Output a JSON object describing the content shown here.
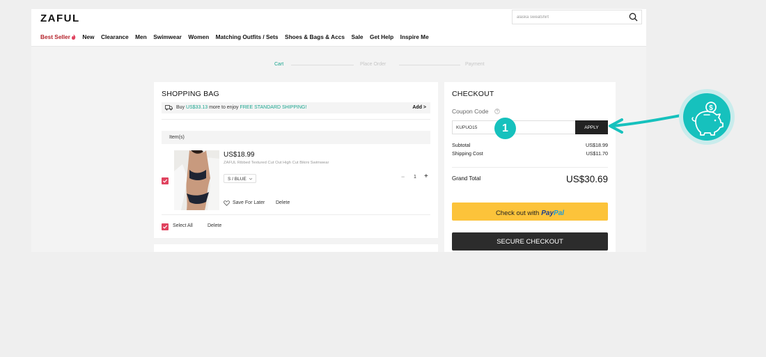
{
  "header": {
    "logo": "ZAFUL",
    "search_placeholder": "alaska sweatshirt",
    "nav": [
      "Best Seller",
      "New",
      "Clearance",
      "Men",
      "Swimwear",
      "Women",
      "Matching Outfits / Sets",
      "Shoes & Bags & Accs",
      "Sale",
      "Get Help",
      "Inspire Me"
    ]
  },
  "steps": [
    "Cart",
    "Place Order",
    "Payment"
  ],
  "bag": {
    "title": "SHOPPING BAG",
    "ship_prefix": "Buy ",
    "ship_amount": "US$33.13",
    "ship_middle": " more to enjoy ",
    "ship_offer": "FREE STANDARD SHIPPING!",
    "add_link": "Add >",
    "items_header": "Item(s)",
    "item": {
      "price": "US$18.99",
      "name": "ZAFUL Ribbed Textured Cut Out High Cut Bikini Swimwear",
      "variant": "S / BLUE",
      "qty": "1",
      "save_later": "Save For Later",
      "delete": "Delete"
    },
    "select_all": "Select All",
    "delete": "Delete"
  },
  "checkout": {
    "title": "CHECKOUT",
    "coupon_label": "Coupon Code",
    "coupon_value": "KUPUO15",
    "apply": "APPLY",
    "subtotal_label": "Subtotal",
    "subtotal_value": "US$18.99",
    "shipping_label": "Shipping Cost",
    "shipping_value": "US$11.70",
    "grand_label": "Grand Total",
    "grand_value": "US$30.69",
    "paypal_text": "Check out with",
    "paypal_brand_a": "Pay",
    "paypal_brand_b": "Pal",
    "secure": "SECURE CHECKOUT"
  },
  "annotation": {
    "step_number": "1"
  },
  "colors": {
    "accent": "#1aa58f",
    "highlight": "#16c1bd",
    "checkbox": "#e0435f",
    "paypal": "#fcc33a",
    "hot": "#b4232b"
  }
}
